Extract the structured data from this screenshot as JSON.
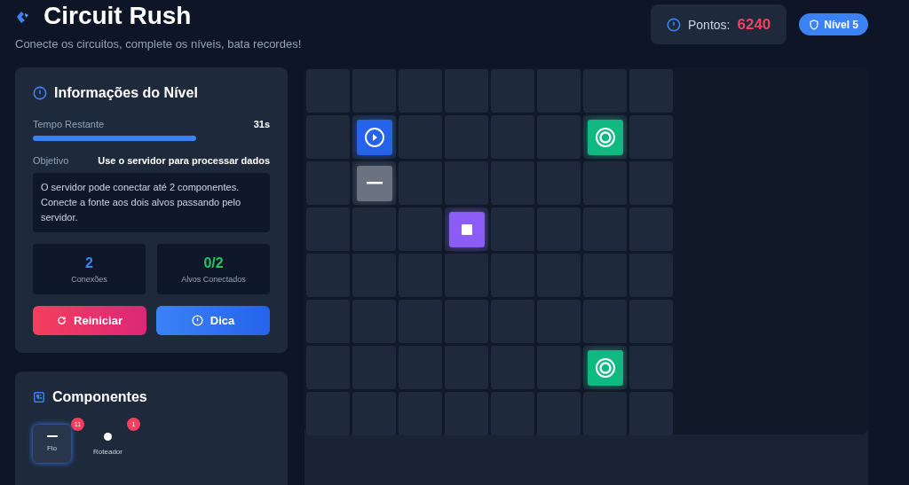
{
  "header": {
    "title": "Circuit Rush",
    "subtitle": "Conecte os circuitos, complete os níveis, bata recordes!",
    "score_label": "Pontos:",
    "score": "6240",
    "level_badge": "Nível 5"
  },
  "level_info": {
    "title": "Informações do Nível",
    "timer_label": "Tempo Restante",
    "timer_value": "31s",
    "timer": {
      "level": 0.69
    },
    "objective_label": "Objetivo",
    "objective": "Use o servidor para processar dados",
    "description": "O servidor pode conectar até 2 componentes. Conecte a fonte aos dois alvos passando pelo servidor.",
    "stats": [
      {
        "value": "2",
        "label": "Conexões",
        "color": "#3b82f6"
      },
      {
        "value": "0/2",
        "label": "Alvos Conectados",
        "color": "#22c55e"
      }
    ],
    "buttons": [
      {
        "kind": "restart",
        "label": "Reiniciar"
      },
      {
        "kind": "hint",
        "label": "Dica"
      }
    ]
  },
  "components": {
    "title": "Componentes",
    "items": [
      {
        "kind": "wire",
        "label": "Fio",
        "count": "11",
        "selected": true
      },
      {
        "kind": "router",
        "label": "Roteador",
        "count": "1",
        "selected": false
      }
    ]
  },
  "board": {
    "rows": [
      [
        {
          "kind": "empty"
        },
        {
          "kind": "empty"
        },
        {
          "kind": "empty"
        },
        {
          "kind": "empty"
        },
        {
          "kind": "empty"
        },
        {
          "kind": "empty"
        },
        {
          "kind": "empty"
        },
        {
          "kind": "empty"
        }
      ],
      [
        {
          "kind": "empty"
        },
        {
          "kind": "source"
        },
        {
          "kind": "empty"
        },
        {
          "kind": "empty"
        },
        {
          "kind": "empty"
        },
        {
          "kind": "empty"
        },
        {
          "kind": "target"
        },
        {
          "kind": "empty"
        }
      ],
      [
        {
          "kind": "empty"
        },
        {
          "kind": "wire"
        },
        {
          "kind": "empty"
        },
        {
          "kind": "empty"
        },
        {
          "kind": "empty"
        },
        {
          "kind": "empty"
        },
        {
          "kind": "empty"
        },
        {
          "kind": "empty"
        }
      ],
      [
        {
          "kind": "empty"
        },
        {
          "kind": "empty"
        },
        {
          "kind": "empty"
        },
        {
          "kind": "server"
        },
        {
          "kind": "empty"
        },
        {
          "kind": "empty"
        },
        {
          "kind": "empty"
        },
        {
          "kind": "empty"
        }
      ],
      [
        {
          "kind": "empty"
        },
        {
          "kind": "empty"
        },
        {
          "kind": "empty"
        },
        {
          "kind": "empty"
        },
        {
          "kind": "empty"
        },
        {
          "kind": "empty"
        },
        {
          "kind": "empty"
        },
        {
          "kind": "empty"
        }
      ],
      [
        {
          "kind": "empty"
        },
        {
          "kind": "empty"
        },
        {
          "kind": "empty"
        },
        {
          "kind": "empty"
        },
        {
          "kind": "empty"
        },
        {
          "kind": "empty"
        },
        {
          "kind": "empty"
        },
        {
          "kind": "empty"
        }
      ],
      [
        {
          "kind": "empty"
        },
        {
          "kind": "empty"
        },
        {
          "kind": "empty"
        },
        {
          "kind": "empty"
        },
        {
          "kind": "empty"
        },
        {
          "kind": "empty"
        },
        {
          "kind": "target"
        },
        {
          "kind": "empty"
        }
      ],
      [
        {
          "kind": "empty"
        },
        {
          "kind": "empty"
        },
        {
          "kind": "empty"
        },
        {
          "kind": "empty"
        },
        {
          "kind": "empty"
        },
        {
          "kind": "empty"
        },
        {
          "kind": "empty"
        },
        {
          "kind": "empty"
        }
      ]
    ]
  }
}
